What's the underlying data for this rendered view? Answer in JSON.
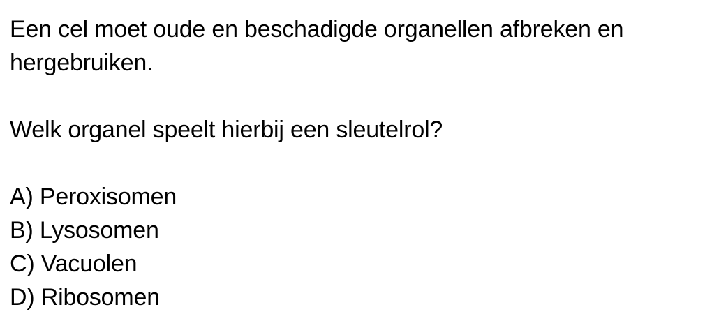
{
  "question": {
    "stem": "Een cel moet oude en beschadigde organellen afbreken en hergebruiken.",
    "prompt": "Welk organel speelt hierbij een sleutelrol?"
  },
  "options": [
    {
      "letter": "A)",
      "text": "Peroxisomen"
    },
    {
      "letter": "B)",
      "text": "Lysosomen"
    },
    {
      "letter": "C)",
      "text": "Vacuolen"
    },
    {
      "letter": "D)",
      "text": "Ribosomen"
    }
  ]
}
